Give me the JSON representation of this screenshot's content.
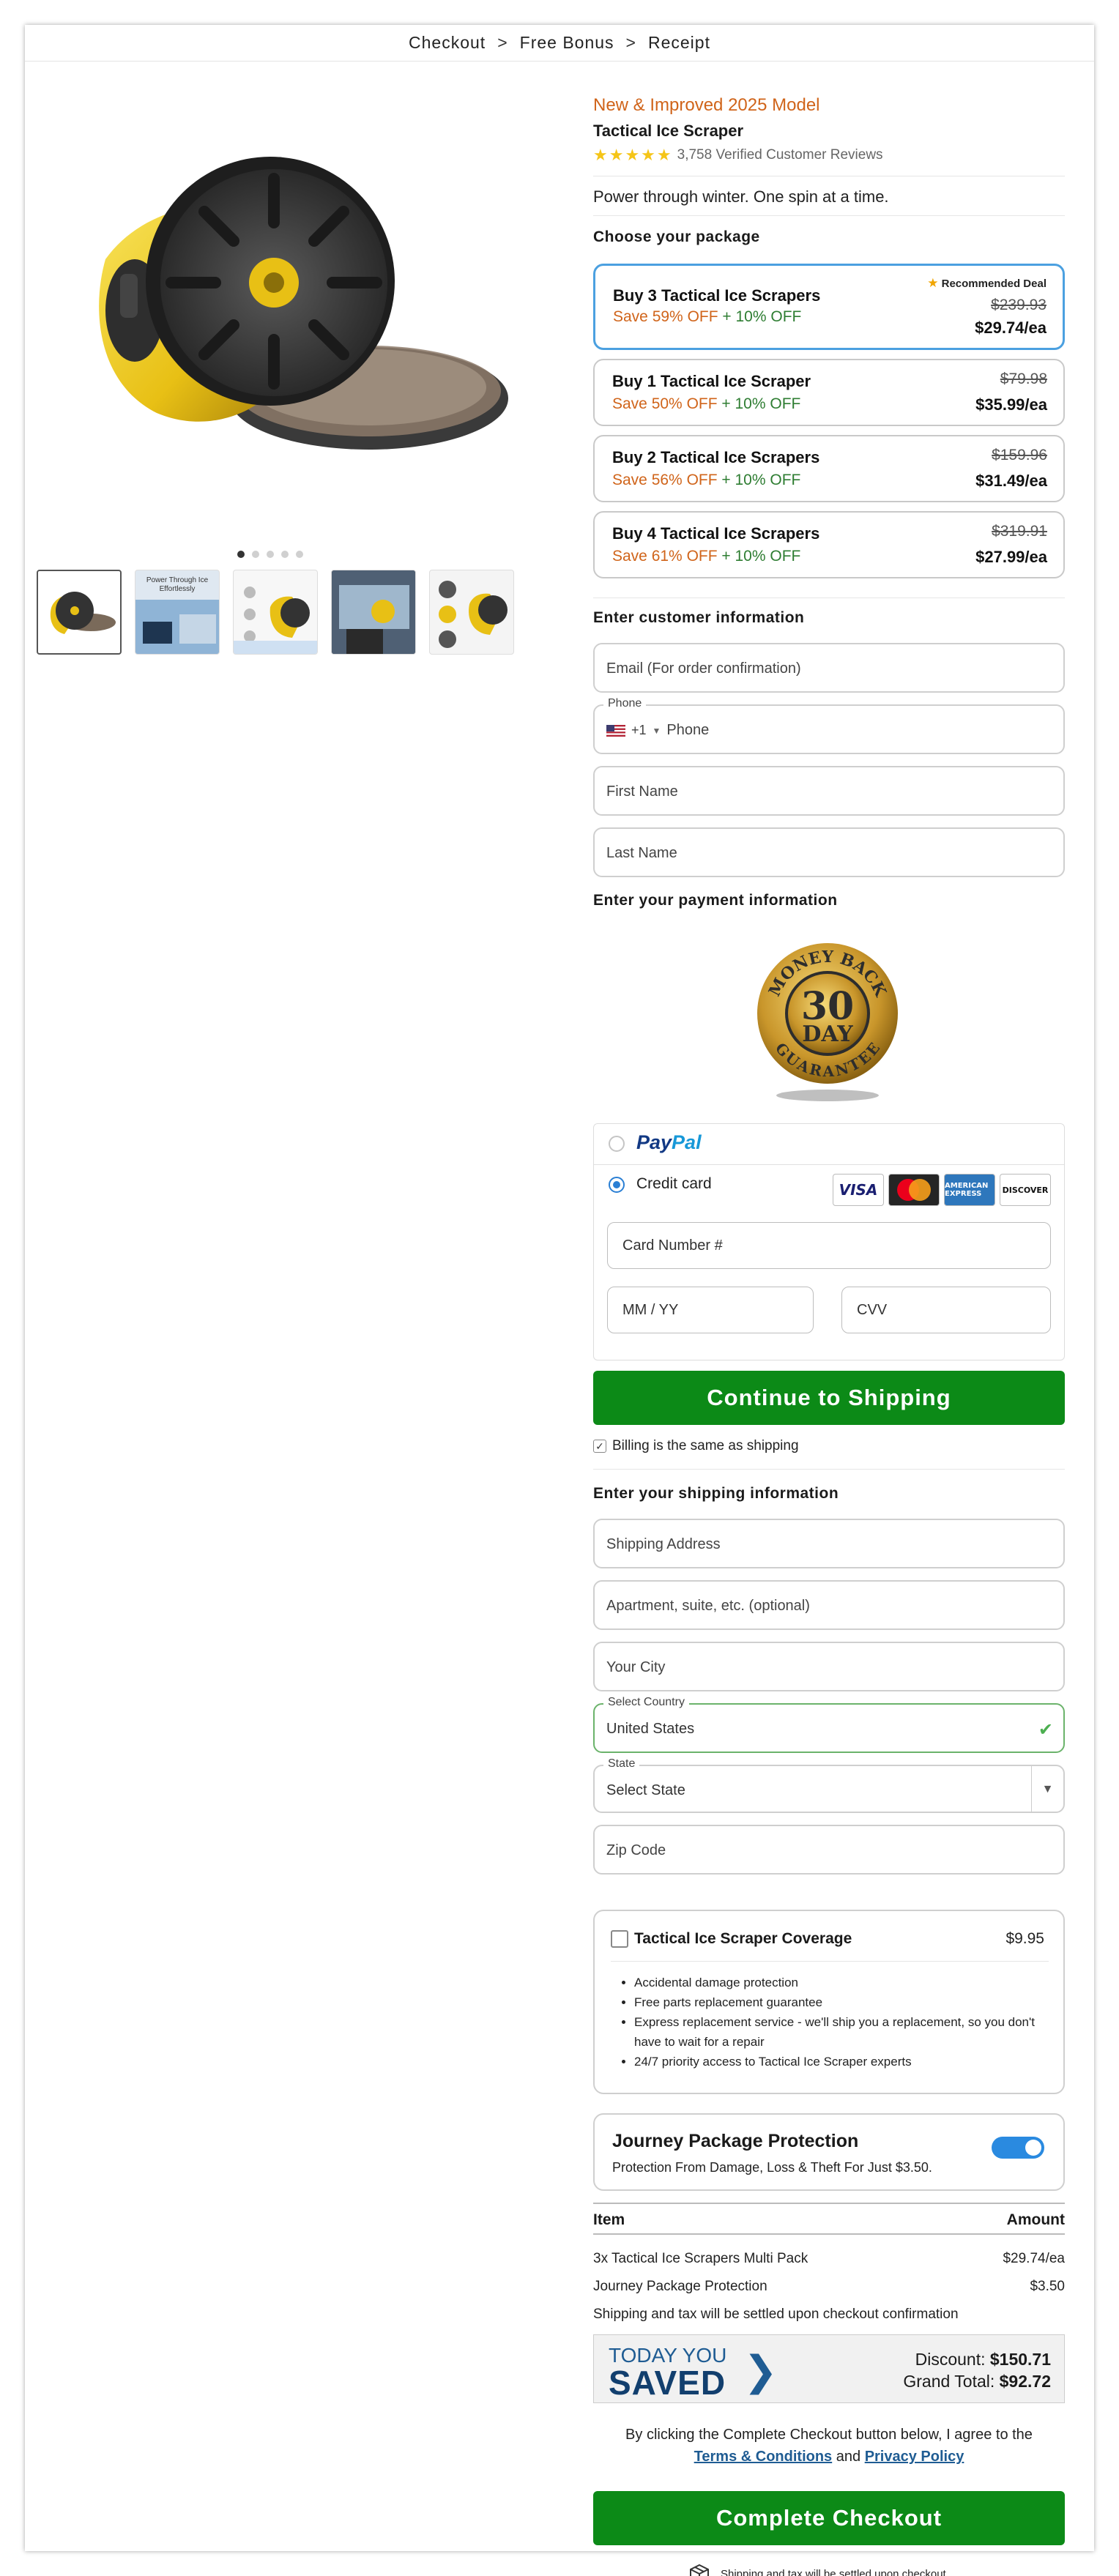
{
  "breadcrumb": {
    "step1": "Checkout",
    "step2": "Free Bonus",
    "step3": "Receipt",
    "separator": ">"
  },
  "gallery": {
    "thumb2_text": "Power Through Ice Effortlessly"
  },
  "product": {
    "model_line": "New & Improved 2025 Model",
    "name": "Tactical Ice Scraper",
    "stars": "★★★★★",
    "reviews": "3,758 Verified Customer Reviews",
    "tagline": "Power through winter. One spin at a time."
  },
  "packages": {
    "title": "Choose your package",
    "recommended": "Recommended Deal",
    "items": [
      {
        "title": "Buy 3 Tactical Ice Scrapers",
        "save": "Save 59% OFF",
        "plus": "+ 10% OFF",
        "old": "$239.93",
        "price": "$29.74/ea"
      },
      {
        "title": "Buy 1 Tactical Ice Scraper",
        "save": "Save 50% OFF",
        "plus": "+ 10% OFF",
        "old": "$79.98",
        "price": "$35.99/ea"
      },
      {
        "title": "Buy 2 Tactical Ice Scrapers",
        "save": "Save 56% OFF",
        "plus": "+ 10% OFF",
        "old": "$159.96",
        "price": "$31.49/ea"
      },
      {
        "title": "Buy 4 Tactical Ice Scrapers",
        "save": "Save 61% OFF",
        "plus": "+ 10% OFF",
        "old": "$319.91",
        "price": "$27.99/ea"
      }
    ]
  },
  "customer": {
    "title": "Enter customer information",
    "email_ph": "Email (For order confirmation)",
    "phone_label": "Phone",
    "phone_code": "+1",
    "phone_ph": "Phone",
    "first_ph": "First Name",
    "last_ph": "Last Name"
  },
  "payment": {
    "title": "Enter your payment information",
    "badge_top": "MONEY BACK",
    "badge_num": "30",
    "badge_day": "DAY",
    "badge_bottom": "GUARANTEE",
    "paypal_a": "Pay",
    "paypal_b": "Pal",
    "credit_label": "Credit card",
    "cards": [
      "VISA",
      "MasterCard",
      "AMERICAN EXPRESS",
      "DISCOVER"
    ],
    "card_ph": "Card Number #",
    "exp_ph": "MM / YY",
    "cvv_ph": "CVV",
    "continue_btn": "Continue to Shipping",
    "billing_same": "Billing is the same as shipping"
  },
  "shipping": {
    "title": "Enter your shipping information",
    "address_ph": "Shipping Address",
    "apt_ph": "Apartment, suite, etc. (optional)",
    "city_ph": "Your City",
    "country_label": "Select Country",
    "country_value": "United States",
    "state_label": "State",
    "state_value": "Select State",
    "zip_ph": "Zip Code"
  },
  "coverage": {
    "title": "Tactical Ice Scraper Coverage",
    "price": "$9.95",
    "items": [
      "Accidental damage protection",
      "Free parts replacement guarantee",
      "Express replacement service - we'll ship you a replacement, so you don't have to wait for a repair",
      "24/7 priority access to Tactical Ice Scraper experts"
    ]
  },
  "journey": {
    "title": "Journey Package Protection",
    "subtitle": "Protection From Damage, Loss & Theft For Just $3.50.",
    "enabled": true
  },
  "summary": {
    "col_item": "Item",
    "col_amount": "Amount",
    "rows": [
      {
        "item": "3x Tactical Ice Scrapers Multi Pack",
        "amount": "$29.74/ea"
      },
      {
        "item": "Journey Package Protection",
        "amount": "$3.50"
      }
    ],
    "note": "Shipping and tax will be settled upon checkout confirmation"
  },
  "saved": {
    "today": "TODAY YOU",
    "saved": "SAVED",
    "discount_label": "Discount:",
    "discount_value": "$150.71",
    "grand_label": "Grand Total:",
    "grand_value": "$92.72"
  },
  "agreement": {
    "text": "By clicking the Complete Checkout button below, I agree to the",
    "terms": "Terms & Conditions",
    "and": "and",
    "privacy": "Privacy Policy"
  },
  "checkout": {
    "button": "Complete Checkout",
    "footer_note": "Shipping and tax will be settled upon checkout"
  },
  "colors": {
    "accent_orange": "#d0641a",
    "save_green": "#2e7d32",
    "button_green": "#0c8a17",
    "selected_blue": "#4ba0e0",
    "link_blue": "#1f5c93"
  }
}
